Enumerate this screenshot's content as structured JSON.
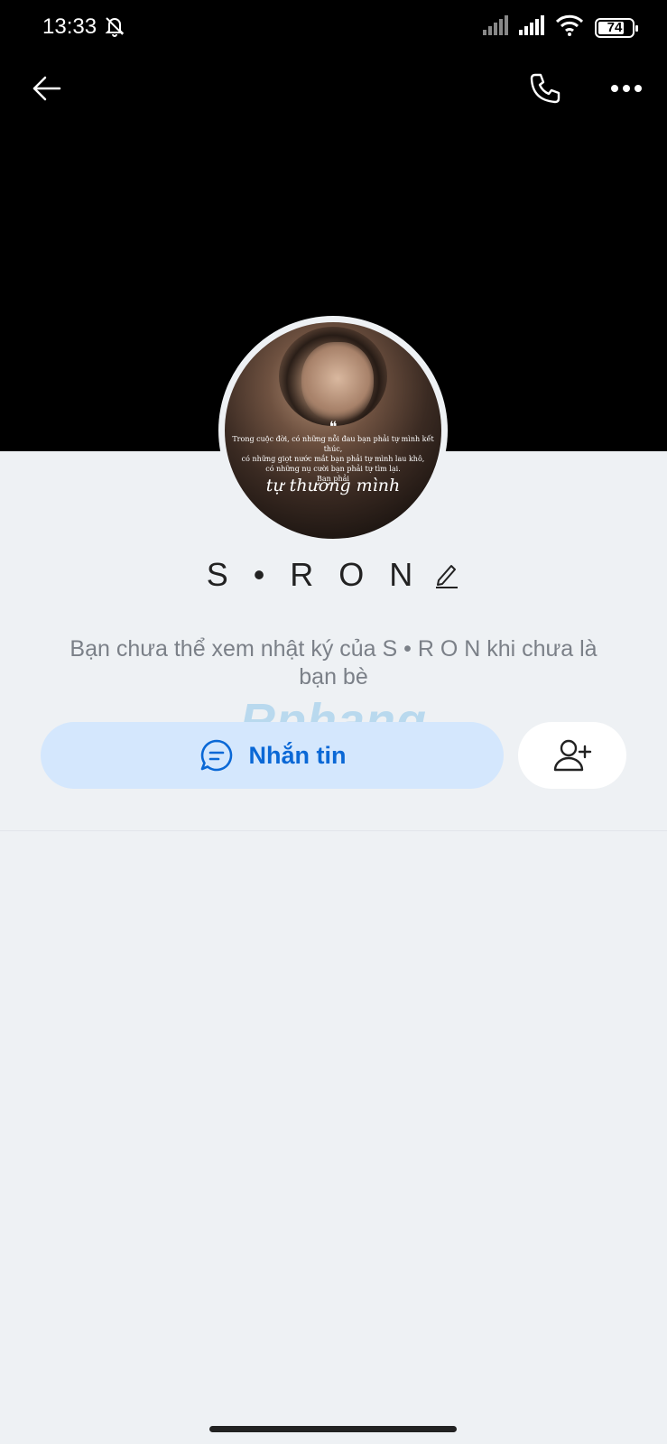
{
  "status_bar": {
    "time": "13:33",
    "battery": "74"
  },
  "profile": {
    "name": "S • R O N",
    "avatar_quote": {
      "line1": "Trong cuộc đời, có những nỗi đau bạn phải tự mình kết thúc,",
      "line2": "có những giọt nước mắt bạn phải tự mình lau khô,",
      "line3": "có những nụ cười bạn phải tự tìm lại.",
      "line4": "Bạn phải",
      "signature": "tự thương mình"
    }
  },
  "notice": "Bạn chưa thể xem nhật ký của S • R O N khi chưa là bạn bè",
  "actions": {
    "message_label": "Nhắn tin"
  },
  "watermark": "Rphang",
  "colors": {
    "accent": "#0a68d6",
    "message_bg": "#d4e7fd",
    "page_bg": "#eef1f4"
  }
}
